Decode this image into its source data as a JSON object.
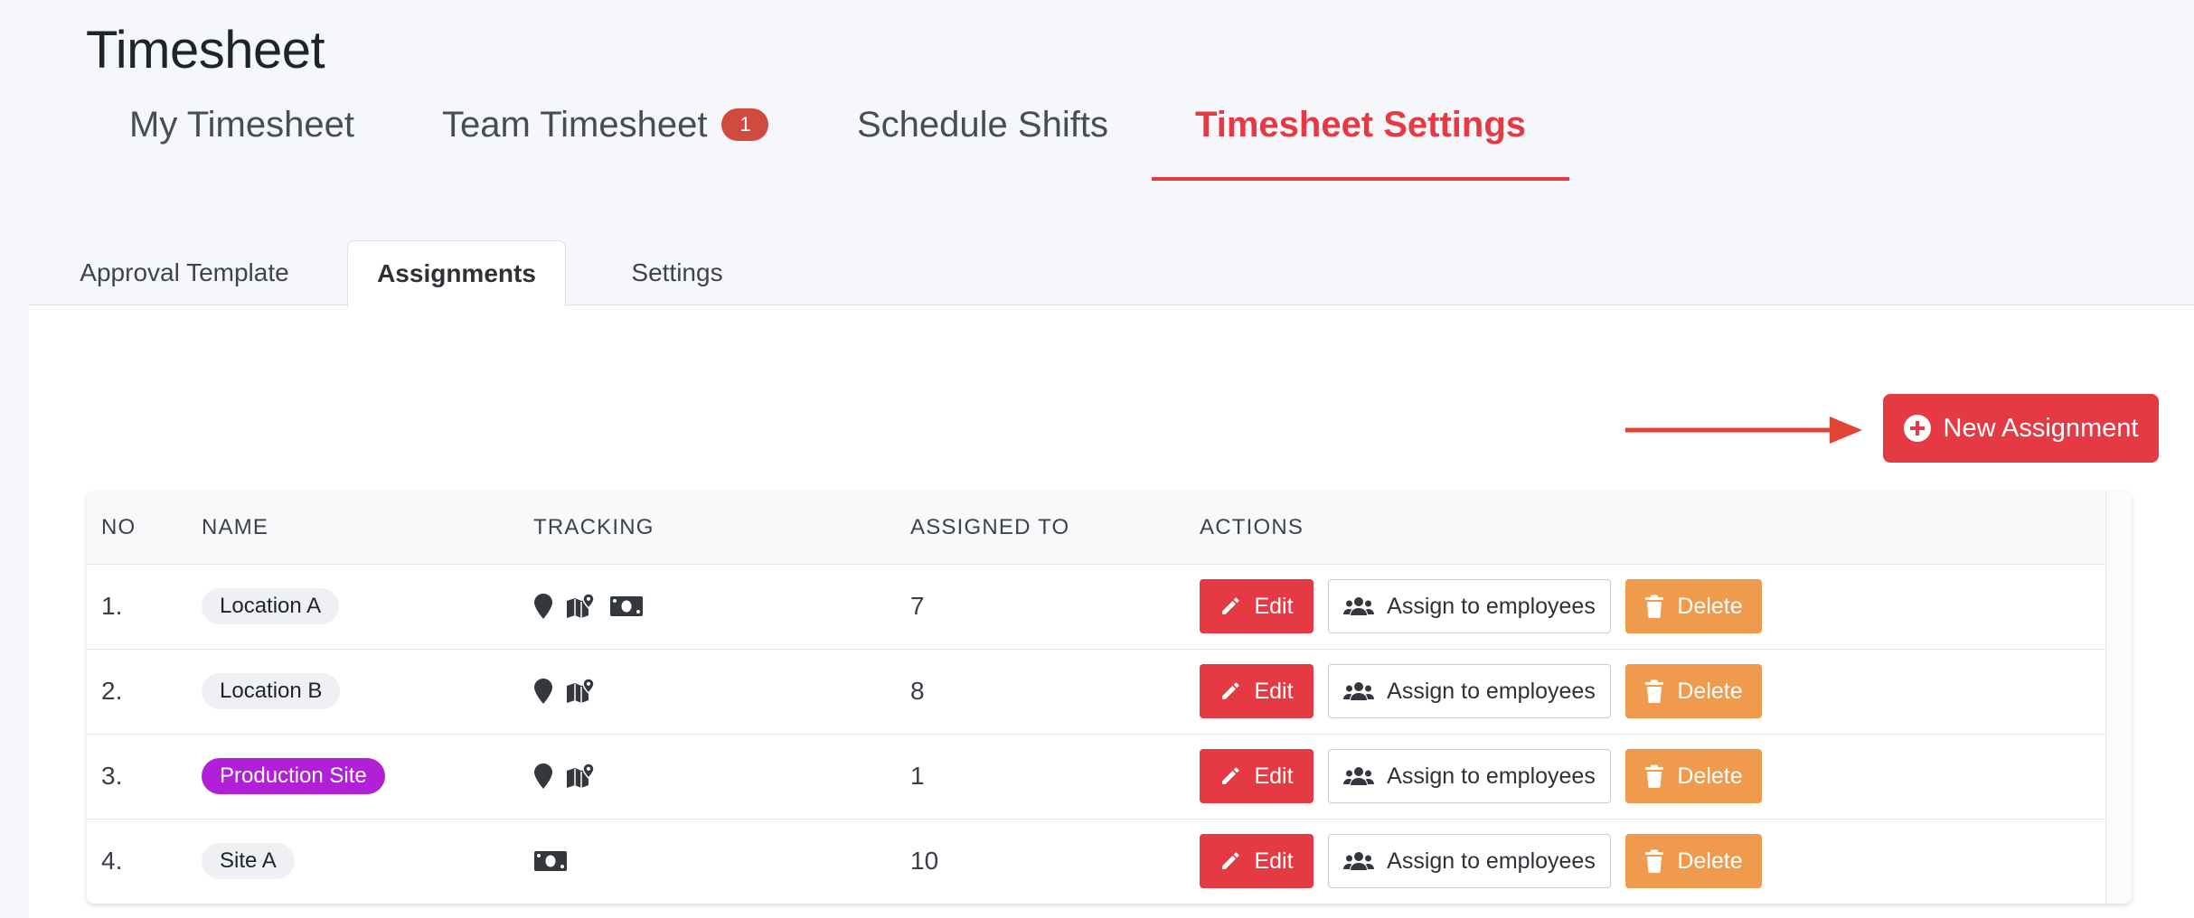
{
  "header": {
    "title": "Timesheet"
  },
  "main_tabs": [
    {
      "label": "My Timesheet"
    },
    {
      "label": "Team Timesheet",
      "badge": "1"
    },
    {
      "label": "Schedule Shifts"
    },
    {
      "label": "Timesheet Settings",
      "active": true
    }
  ],
  "sub_tabs": [
    {
      "label": "Approval Template"
    },
    {
      "label": "Assignments",
      "active": true
    },
    {
      "label": "Settings"
    }
  ],
  "toolbar": {
    "new_assignment_label": "New Assignment",
    "new_assignment_icon": "plus-circle-icon"
  },
  "table": {
    "columns": [
      "NO",
      "NAME",
      "TRACKING",
      "ASSIGNED TO",
      "ACTIONS"
    ],
    "rows": [
      {
        "no": "1.",
        "name": "Location A",
        "tracking": [
          "location-pin-icon",
          "map-icon",
          "money-icon"
        ],
        "assigned_to": "7"
      },
      {
        "no": "2.",
        "name": "Location B",
        "tracking": [
          "location-pin-icon",
          "map-icon"
        ],
        "assigned_to": "8"
      },
      {
        "no": "3.",
        "name": "Production Site",
        "name_highlight": true,
        "tracking": [
          "location-pin-icon",
          "map-icon"
        ],
        "assigned_to": "1"
      },
      {
        "no": "4.",
        "name": "Site A",
        "tracking": [
          "money-icon"
        ],
        "assigned_to": "10"
      }
    ],
    "actions": {
      "edit": "Edit",
      "assign": "Assign to employees",
      "delete": "Delete"
    }
  },
  "colors": {
    "accent": "#e53a44",
    "badge": "#d04a3f",
    "delete": "#ef9a4d",
    "highlight_pill": "#b11fd6"
  }
}
